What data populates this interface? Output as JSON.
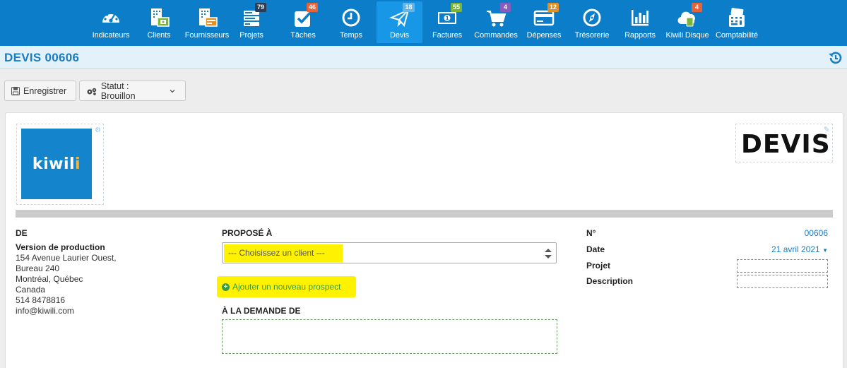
{
  "nav": {
    "items": [
      {
        "label": "Indicateurs",
        "icon": "gauge-icon"
      },
      {
        "label": "Clients",
        "icon": "clients-building-icon"
      },
      {
        "label": "Fournisseurs",
        "icon": "suppliers-building-icon"
      },
      {
        "label": "Projets",
        "icon": "projects-icon",
        "badge": "79",
        "badge_color": "#2a3d55"
      },
      {
        "label": "Tâches",
        "icon": "tasks-check-icon",
        "badge": "46",
        "badge_color": "#e8623a"
      },
      {
        "label": "Temps",
        "icon": "clock-icon"
      },
      {
        "label": "Devis",
        "icon": "paper-plane-icon",
        "badge": "18",
        "badge_color": "#5fb6ee",
        "active": true
      },
      {
        "label": "Factures",
        "icon": "invoice-icon",
        "badge": "55",
        "badge_color": "#7ab53a"
      },
      {
        "label": "Commandes",
        "icon": "cart-icon",
        "badge": "4",
        "badge_color": "#8a5bbf"
      },
      {
        "label": "Dépenses",
        "icon": "credit-card-icon",
        "badge": "12",
        "badge_color": "#e58f20"
      },
      {
        "label": "Trésorerie",
        "icon": "compass-icon"
      },
      {
        "label": "Rapports",
        "icon": "bar-chart-icon"
      },
      {
        "label": "Kiwili Disque",
        "icon": "cloud-drive-icon",
        "badge": "4",
        "badge_color": "#e8623a"
      },
      {
        "label": "Comptabilité",
        "icon": "calculator-icon"
      }
    ]
  },
  "page": {
    "title": "DEVIS 00606"
  },
  "toolbar": {
    "save_label": "Enregistrer",
    "status_label": "Statut : Brouillon"
  },
  "doc": {
    "logo_text": "kiwili",
    "heading": "DEVIS",
    "from": {
      "title": "DE",
      "company": "Version de production",
      "address_lines": [
        "154 Avenue Laurier Ouest,",
        "Bureau 240",
        "Montréal, Québec",
        "Canada",
        "514 8478816",
        "info@kiwili.com"
      ]
    },
    "to": {
      "title": "PROPOSÉ À",
      "client_placeholder": "--- Choisissez un client ---",
      "add_prospect_label": "Ajouter un nouveau prospect",
      "requested_by_title": "À LA DEMANDE DE"
    },
    "meta": {
      "number_label": "N°",
      "number_value": "00606",
      "date_label": "Date",
      "date_value": "21 avril 2021",
      "project_label": "Projet",
      "description_label": "Description"
    }
  },
  "colors": {
    "nav_bg": "#0b7dc9",
    "accent": "#1a7dc2",
    "highlight": "#fff200",
    "link_green": "#3f9a3f"
  }
}
